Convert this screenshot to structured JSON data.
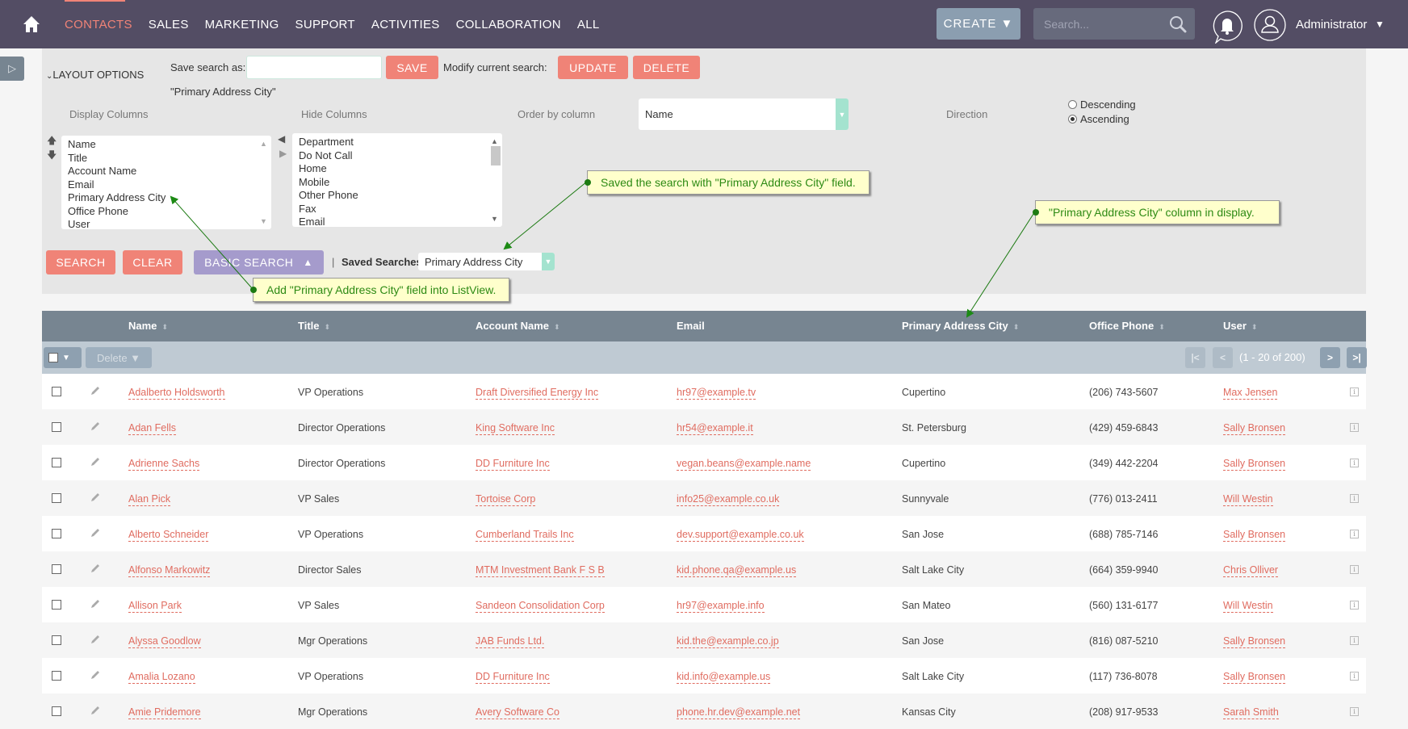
{
  "topnav": {
    "tabs": [
      {
        "label": "CONTACTS",
        "active": true
      },
      {
        "label": "SALES"
      },
      {
        "label": "MARKETING"
      },
      {
        "label": "SUPPORT"
      },
      {
        "label": "ACTIVITIES"
      },
      {
        "label": "COLLABORATION"
      },
      {
        "label": "ALL"
      }
    ],
    "create_label": "CREATE ▼",
    "search_placeholder": "Search...",
    "user_name": "Administrator",
    "user_caret": "▼",
    "accent_color": "#f08377"
  },
  "search_panel": {
    "layout_options_label": "LAYOUT OPTIONS",
    "save_search_as_label": "Save search as:",
    "save_search_value": "",
    "save_label": "SAVE",
    "modify_current_label": "Modify current search:",
    "update_label": "UPDATE",
    "delete_label": "DELETE",
    "current_search_name": "\"Primary Address City\"",
    "display_columns_label": "Display Columns",
    "hide_columns_label": "Hide Columns",
    "order_by_label": "Order by column",
    "order_by_value": "Name",
    "direction_label": "Direction",
    "direction_options": [
      {
        "label": "Descending",
        "checked": false
      },
      {
        "label": "Ascending",
        "checked": true
      }
    ],
    "display_columns": [
      "Name",
      "Title",
      "Account Name",
      "Email",
      "Primary Address City",
      "Office Phone",
      "User"
    ],
    "hide_columns": [
      "Department",
      "Do Not Call",
      "Home",
      "Mobile",
      "Other Phone",
      "Fax",
      "Email"
    ],
    "search_label": "SEARCH",
    "clear_label": "CLEAR",
    "basic_search_label": "BASIC SEARCH",
    "basic_search_caret": "▲",
    "divider": "|",
    "saved_searches_label": "Saved Searches",
    "saved_searches_value": "Primary Address City"
  },
  "annotations": [
    {
      "text": "Saved the search with \"Primary Address City\" field."
    },
    {
      "text": "\"Primary Address City\" column in display."
    },
    {
      "text": "Add \"Primary Address City\" field into ListView."
    }
  ],
  "table": {
    "columns": [
      {
        "label": "Name",
        "sortable": true
      },
      {
        "label": "Title",
        "sortable": true
      },
      {
        "label": "Account Name",
        "sortable": true
      },
      {
        "label": "Email",
        "sortable": false
      },
      {
        "label": "Primary Address City",
        "sortable": true
      },
      {
        "label": "Office Phone",
        "sortable": true
      },
      {
        "label": "User",
        "sortable": true
      }
    ],
    "bulk_delete_label": "Delete ▼",
    "pagination": {
      "first": "|<",
      "prev": "<",
      "count": "(1 - 20 of 200)",
      "next": ">",
      "last": ">|"
    },
    "rows": [
      {
        "name": "Adalberto Holdsworth",
        "title": "VP Operations",
        "account": "Draft Diversified Energy Inc",
        "email": "hr97@example.tv",
        "city": "Cupertino",
        "phone": "(206) 743-5607",
        "user": "Max Jensen"
      },
      {
        "name": "Adan Fells",
        "title": "Director Operations",
        "account": "King Software Inc",
        "email": "hr54@example.it",
        "city": "St. Petersburg",
        "phone": "(429) 459-6843",
        "user": "Sally Bronsen"
      },
      {
        "name": "Adrienne Sachs",
        "title": "Director Operations",
        "account": "DD Furniture Inc",
        "email": "vegan.beans@example.name",
        "city": "Cupertino",
        "phone": "(349) 442-2204",
        "user": "Sally Bronsen"
      },
      {
        "name": "Alan Pick",
        "title": "VP Sales",
        "account": "Tortoise Corp",
        "email": "info25@example.co.uk",
        "city": "Sunnyvale",
        "phone": "(776) 013-2411",
        "user": "Will Westin"
      },
      {
        "name": "Alberto Schneider",
        "title": "VP Operations",
        "account": "Cumberland Trails Inc",
        "email": "dev.support@example.co.uk",
        "city": "San Jose",
        "phone": "(688) 785-7146",
        "user": "Sally Bronsen"
      },
      {
        "name": "Alfonso Markowitz",
        "title": "Director Sales",
        "account": "MTM Investment Bank F S B",
        "email": "kid.phone.qa@example.us",
        "city": "Salt Lake City",
        "phone": "(664) 359-9940",
        "user": "Chris Olliver"
      },
      {
        "name": "Allison Park",
        "title": "VP Sales",
        "account": "Sandeon Consolidation Corp",
        "email": "hr97@example.info",
        "city": "San Mateo",
        "phone": "(560) 131-6177",
        "user": "Will Westin"
      },
      {
        "name": "Alyssa Goodlow",
        "title": "Mgr Operations",
        "account": "JAB Funds Ltd.",
        "email": "kid.the@example.co.jp",
        "city": "San Jose",
        "phone": "(816) 087-5210",
        "user": "Sally Bronsen"
      },
      {
        "name": "Amalia Lozano",
        "title": "VP Operations",
        "account": "DD Furniture Inc",
        "email": "kid.info@example.us",
        "city": "Salt Lake City",
        "phone": "(117) 736-8078",
        "user": "Sally Bronsen"
      },
      {
        "name": "Amie Pridemore",
        "title": "Mgr Operations",
        "account": "Avery Software Co",
        "email": "phone.hr.dev@example.net",
        "city": "Kansas City",
        "phone": "(208) 917-9533",
        "user": "Sarah Smith"
      }
    ]
  }
}
